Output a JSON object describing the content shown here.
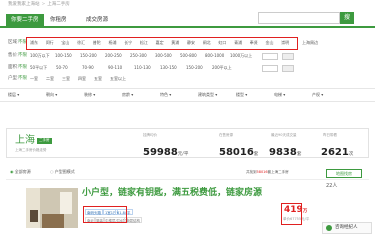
{
  "breadcrumb": {
    "site": "我爱我家上海站",
    "current": "上海二手房"
  },
  "tabs": [
    {
      "label": "你要二手房",
      "active": true
    },
    {
      "label": "你租房",
      "active": false
    },
    {
      "label": "成交房源",
      "active": false
    }
  ],
  "search": {
    "button_label": "搜"
  },
  "filters": {
    "district_label": "区域：",
    "district_any": "不限",
    "districts": [
      "浦东",
      "闵行",
      "宝山",
      "徐汇",
      "普陀",
      "杨浦",
      "长宁",
      "松江",
      "嘉定",
      "黄浦",
      "静安",
      "闸北",
      "虹口",
      "青浦",
      "奉贤",
      "金山",
      "崇明",
      "上海周边"
    ],
    "price_label": "售价：",
    "price_any": "不限",
    "prices": [
      "100万以下",
      "100-150",
      "150-200",
      "200-250",
      "250-300",
      "300-500",
      "500-800",
      "800-1000",
      "1000万以上"
    ],
    "area_label": "面积：",
    "area_any": "不限",
    "areas": [
      "50平以下",
      "50-70",
      "70-90",
      "90-110",
      "110-130",
      "130-150",
      "150-200",
      "200平以上"
    ],
    "room_label": "户型：",
    "room_any": "不限",
    "rooms": [
      "一室",
      "二室",
      "三室",
      "四室",
      "五室",
      "五室以上"
    ]
  },
  "sort_bar": {
    "items": [
      "楼层",
      "朝向",
      "装修",
      "房龄",
      "特色",
      "建筑类型",
      "楼型",
      "电梯",
      "产权"
    ]
  },
  "stats": {
    "city": "上海",
    "city_badge": "二手房",
    "city_sub": "上海二手房价格走势",
    "avg_price_label": "挂牌均价",
    "avg_price": "59988",
    "avg_price_unit": "元/平",
    "for_sale_label": "在售房源",
    "for_sale": "58016",
    "for_sale_unit": "套",
    "recent_sold_label": "最近90天成交量",
    "recent_sold": "9838",
    "recent_sold_unit": "套",
    "yesterday_label": "昨日带看",
    "yesterday": "2621",
    "yesterday_unit": "次"
  },
  "listbar": {
    "options": [
      "全部房源",
      "户型图模式"
    ],
    "count_prefix": "共找到",
    "count": "58016",
    "count_suffix": "套上海二手房",
    "map_label": "地图找房"
  },
  "listing": {
    "title": "小户型，链家有钥匙，满五税费低，链家房源",
    "chips": [
      {
        "text": "南码头路",
        "style": "blue"
      },
      {
        "text": "1室1厅",
        "style": "blue"
      },
      {
        "text": "61.84平",
        "style": "blue"
      },
      {
        "text": "南北",
        "style": "grey"
      },
      {
        "text": "简装",
        "style": "grey"
      },
      {
        "text": "中楼层/共6层",
        "style": "grey"
      },
      {
        "text": "钢混结构",
        "style": "grey"
      }
    ],
    "price": "419",
    "price_unit": "万",
    "per_m2": "单价67755元/平",
    "followers": "22人",
    "chat": "咨询经纪人"
  },
  "colors": {
    "brand_green": "#3d9a3f",
    "highlight_red": "#e02020"
  },
  "icons": [
    "search-icon",
    "chat-icon"
  ]
}
